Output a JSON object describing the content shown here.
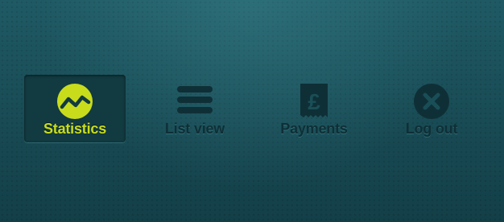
{
  "nav": {
    "active_item": "statistics",
    "items": [
      {
        "id": "statistics",
        "label": "Statistics",
        "icon": "chart-line-circle-icon"
      },
      {
        "id": "list-view",
        "label": "List view",
        "icon": "list-bars-icon"
      },
      {
        "id": "payments",
        "label": "Payments",
        "icon": "pound-receipt-icon"
      },
      {
        "id": "log-out",
        "label": "Log out",
        "icon": "close-circle-icon"
      }
    ]
  },
  "colors": {
    "background": "#1a4e57",
    "active_accent": "#c8dc1c",
    "inactive": "#0f2f36",
    "active_tile": "#123a41"
  }
}
